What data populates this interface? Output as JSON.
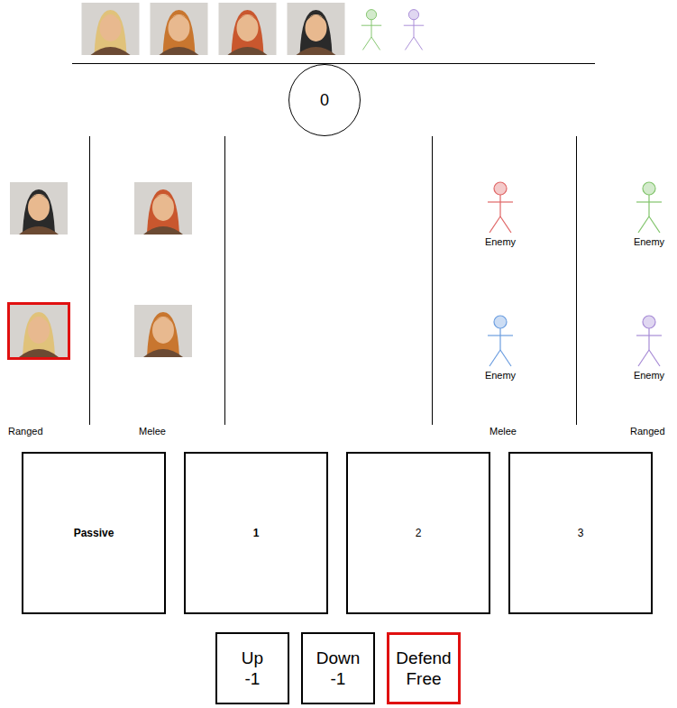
{
  "turn_order": [
    {
      "kind": "hero",
      "color": "#e0c27a"
    },
    {
      "kind": "hero",
      "color": "#c8762f"
    },
    {
      "kind": "hero",
      "color": "#c9572e"
    },
    {
      "kind": "hero",
      "color": "#2a2a2a"
    },
    {
      "kind": "enemy",
      "color": "#82c46c"
    },
    {
      "kind": "enemy",
      "color": "#a78bd6"
    }
  ],
  "round": "0",
  "lanes": [
    {
      "side": "ally",
      "label": "Ranged",
      "units": [
        {
          "kind": "hero",
          "color": "#2a2a2a",
          "selected": false,
          "label": ""
        },
        {
          "kind": "hero",
          "color": "#e0c27a",
          "selected": true,
          "label": ""
        }
      ]
    },
    {
      "side": "ally",
      "label": "Melee",
      "units": [
        {
          "kind": "hero",
          "color": "#c9572e",
          "selected": false,
          "label": ""
        },
        {
          "kind": "hero",
          "color": "#c8762f",
          "selected": false,
          "label": ""
        }
      ]
    },
    {
      "side": "enemy",
      "label": "Melee",
      "units": [
        {
          "kind": "enemy",
          "color": "#e06666",
          "selected": false,
          "label": "Enemy"
        },
        {
          "kind": "enemy",
          "color": "#6c9ee0",
          "selected": false,
          "label": "Enemy"
        }
      ]
    },
    {
      "side": "enemy",
      "label": "Ranged",
      "units": [
        {
          "kind": "enemy",
          "color": "#82c46c",
          "selected": false,
          "label": "Enemy"
        },
        {
          "kind": "enemy",
          "color": "#a78bd6",
          "selected": false,
          "label": "Enemy"
        }
      ]
    }
  ],
  "cards": [
    {
      "label": "Passive",
      "bold": true
    },
    {
      "label": "1",
      "bold": true
    },
    {
      "label": "2",
      "bold": false
    },
    {
      "label": "3",
      "bold": false
    }
  ],
  "actions": [
    {
      "label": "Up",
      "cost": "-1",
      "selected": false
    },
    {
      "label": "Down",
      "cost": "-1",
      "selected": false
    },
    {
      "label": "Defend",
      "cost": "Free",
      "selected": true
    }
  ]
}
